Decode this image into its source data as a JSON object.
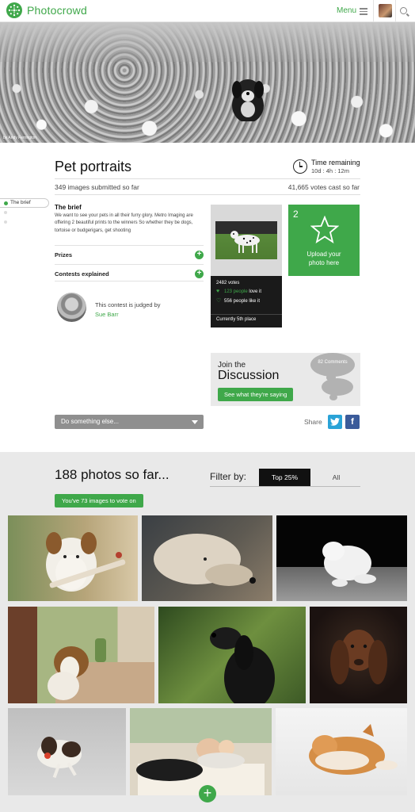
{
  "topbar": {
    "brand": "Photocrowd",
    "menu_label": "Menu",
    "logo_icon": "photocrowd-logo-icon",
    "menu_icon": "hamburger-icon",
    "search_icon": "search-icon"
  },
  "hero": {
    "credit": "by Andy Ferrington"
  },
  "contest": {
    "title": "Pet portraits",
    "time_label": "Time remaining",
    "time_value": "10d : 4h : 12m",
    "images_submitted": "349 images submitted so far",
    "votes_cast": "41,665 votes cast so far"
  },
  "sidenav": {
    "items": [
      {
        "label": "The brief",
        "active": true
      },
      {
        "label": "",
        "active": false
      },
      {
        "label": "",
        "active": false
      }
    ]
  },
  "brief": {
    "heading": "The brief",
    "text": "We want to see your pets in all their furry glory. Metro Imaging are offering 2 beautiful prints to the winners So whether they be dogs, tortoise or budgerigars, get shooting",
    "sections": [
      "Prizes",
      "Contests explained"
    ],
    "judge_text": "This contest is judged by",
    "judge_name": "Sue Barr"
  },
  "leader": {
    "votes": "2482 votes",
    "love_count": "123 people",
    "love_suffix": " love it",
    "like_text": "556 people like it",
    "place": "Currently 5th place"
  },
  "upload": {
    "count": "2",
    "label_line1": "Upload your",
    "label_line2": "photo here"
  },
  "discussion": {
    "pre": "Join the",
    "big": "Discussion",
    "comments": "82 Comments",
    "button": "See what they're saying"
  },
  "actions": {
    "dropdown": "Do something else...",
    "share": "Share",
    "twitter_icon": "twitter-icon",
    "facebook_icon": "facebook-icon"
  },
  "photos": {
    "title": "188 photos so far...",
    "filter_label": "Filter by:",
    "filters": [
      "Top 25%",
      "All"
    ],
    "active_filter": "Top 25%",
    "votes_left": "You've 73 images to vote on"
  },
  "colors": {
    "accent": "#3fa84a",
    "dark": "#1a1a1a",
    "twitter": "#2aa3d7",
    "facebook": "#3b5b9a"
  }
}
